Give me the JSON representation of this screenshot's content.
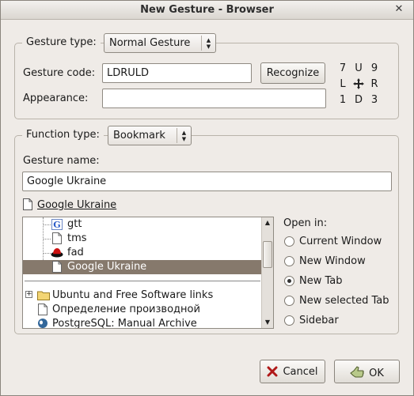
{
  "window": {
    "title": "New Gesture - Browser",
    "close_glyph": "✕"
  },
  "gesture": {
    "type_label": "Gesture type:",
    "type_value": "Normal Gesture",
    "code_label": "Gesture code:",
    "code_value": "LDRULD",
    "recognize_label": "Recognize",
    "appearance_label": "Appearance:",
    "appearance_value": "",
    "grid": [
      "7",
      "U",
      "9",
      "L",
      "",
      "R",
      "1",
      "D",
      "3"
    ]
  },
  "function": {
    "type_label": "Function type:",
    "type_value": "Bookmark",
    "name_label": "Gesture name:",
    "name_value": "Google Ukraine",
    "bookmark_link": "Google Ukraine",
    "tree": [
      {
        "label": "gtt",
        "icon": "google-favicon-icon"
      },
      {
        "label": "tms",
        "icon": "page-icon"
      },
      {
        "label": "fad",
        "icon": "redhat-icon"
      },
      {
        "label": "Google Ukraine",
        "icon": "page-icon",
        "selected": true
      },
      {
        "label": "Ubuntu and Free Software links",
        "icon": "folder-icon",
        "expander": "+"
      },
      {
        "label": "Определение производной",
        "icon": "page-icon"
      },
      {
        "label": "PostgreSQL: Manual Archive",
        "icon": "postgresql-icon"
      }
    ],
    "open_in_label": "Open in:",
    "open_in_options": [
      {
        "label": "Current Window",
        "checked": false
      },
      {
        "label": "New Window",
        "checked": false
      },
      {
        "label": "New Tab",
        "checked": true
      },
      {
        "label": "New selected Tab",
        "checked": false
      },
      {
        "label": "Sidebar",
        "checked": false
      }
    ]
  },
  "footer": {
    "cancel_label": "Cancel",
    "ok_label": "OK"
  }
}
